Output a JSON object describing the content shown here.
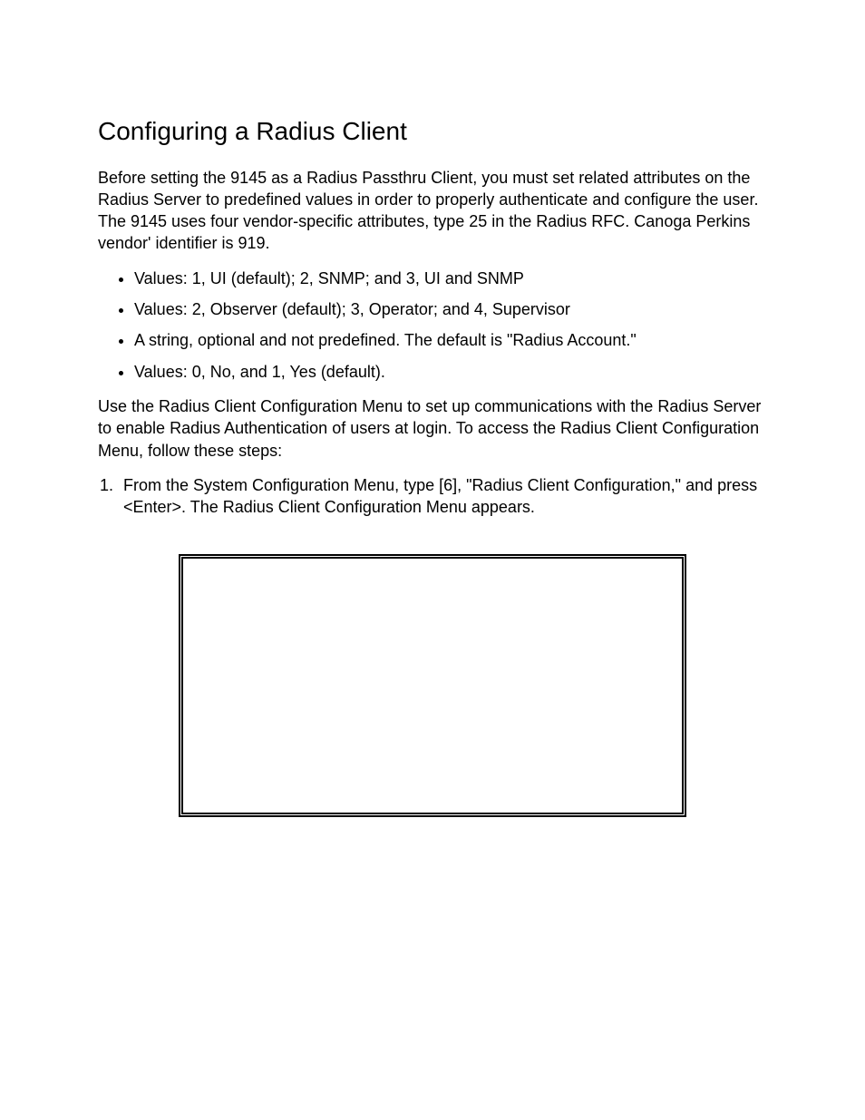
{
  "doc": {
    "title": "Configuring a Radius Client",
    "intro": "Before setting the 9145 as a Radius Passthru Client, you must set related attributes on the Radius Server to predefined values in order to properly authenticate and configure the user.  The 9145 uses four vendor-specific attributes, type 25 in the Radius RFC.  Canoga Perkins vendor' identifier is 919.",
    "bullets": [
      {
        "text": "Values:  1, UI (default); 2, SNMP; and 3, UI and SNMP"
      },
      {
        "text": "Values:  2, Observer (default); 3, Operator; and 4, Supervisor"
      },
      {
        "text": "A string, optional and not predefined.  The default is \"Radius Account.\""
      },
      {
        "text": "Values:  0, No, and 1, Yes (default)."
      }
    ],
    "para2": "Use the Radius Client Configuration Menu to set up communications with the Radius Server to enable Radius Authentication of users at login.  To access the Radius Client Configuration Menu, follow these steps:",
    "steps": [
      {
        "text": "From the System Configuration Menu, type [6], \"Radius Client Configuration,\" and press <Enter>.  The Radius Client Configuration Menu appears."
      }
    ]
  }
}
